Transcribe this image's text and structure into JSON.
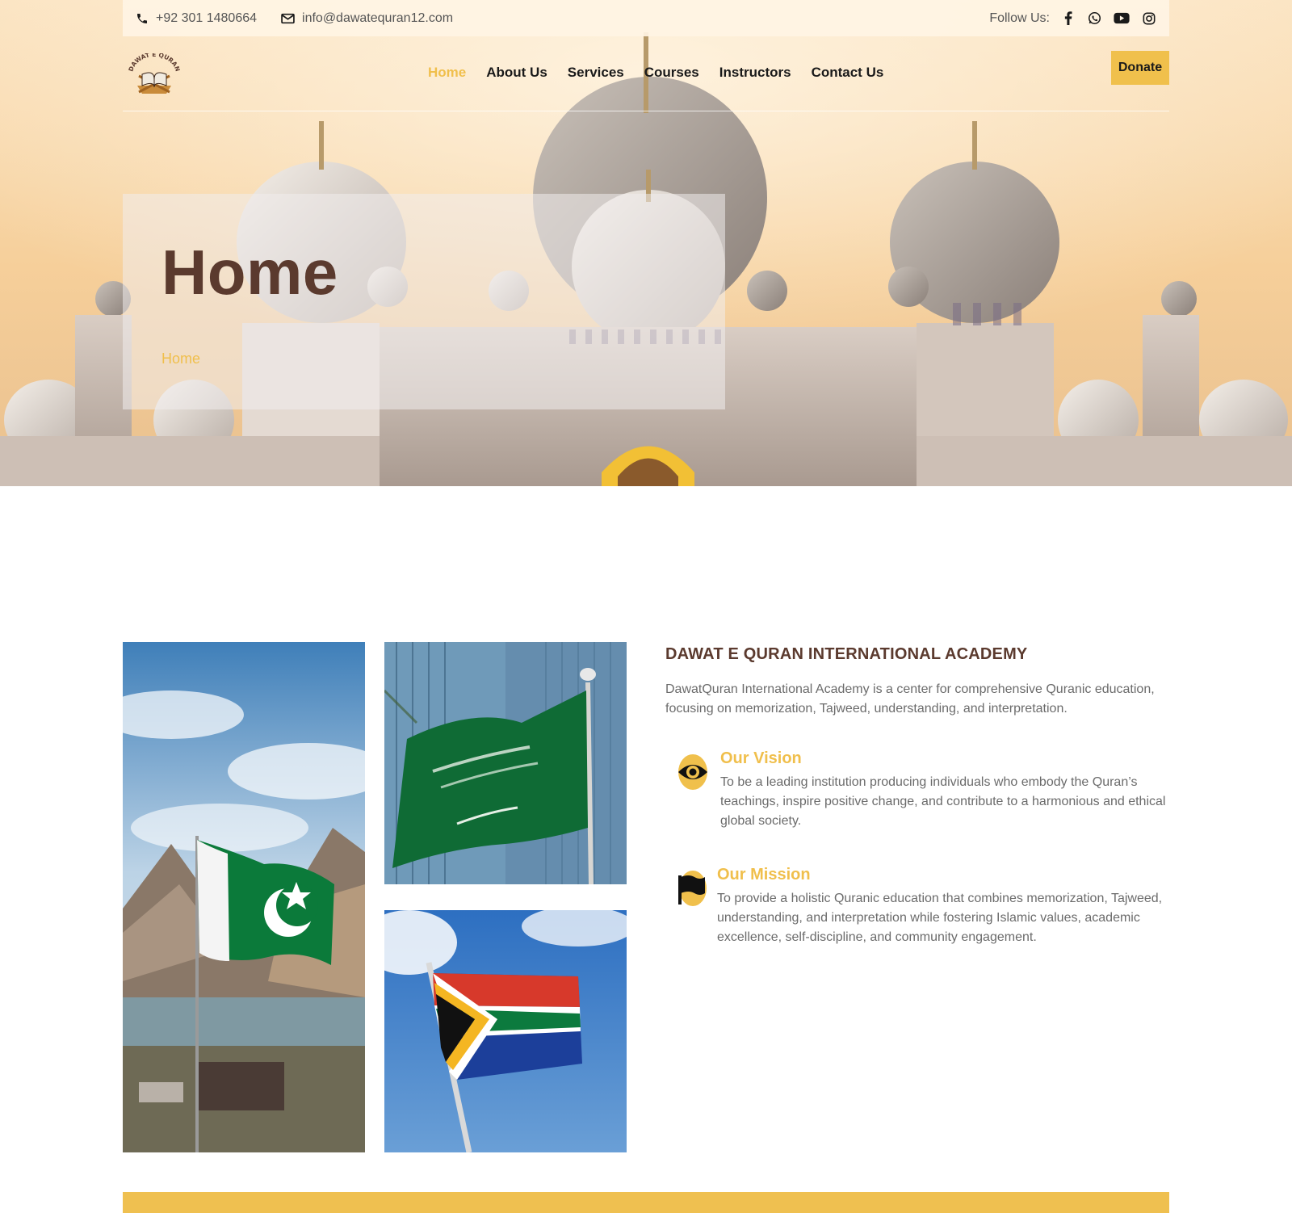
{
  "topbar": {
    "phone": "+92 301 1480664",
    "email": "info@dawatequran12.com",
    "follow_label": "Follow Us:",
    "socials": [
      "facebook-icon",
      "whatsapp-icon",
      "youtube-icon",
      "instagram-icon"
    ]
  },
  "nav": {
    "logo_text": "DAWAT E QURAN",
    "items": [
      "Home",
      "About Us",
      "Services",
      "Courses",
      "Instructors",
      "Contact Us"
    ],
    "active": "Home",
    "donate_label": "Donate"
  },
  "hero": {
    "title": "Home",
    "breadcrumb": "Home"
  },
  "about": {
    "heading": "DAWAT E QURAN INTERNATIONAL ACADEMY",
    "text": "DawatQuran International Academy is a center for comprehensive Quranic education, focusing on memorization, Tajweed, understanding, and interpretation.",
    "vision": {
      "title": "Our Vision",
      "text": "To be a leading institution producing individuals who embody the Quran’s teachings, inspire positive change, and contribute to a harmonious and ethical global society.",
      "icon": "eye-icon"
    },
    "mission": {
      "title": "Our Mission",
      "text": "To provide a holistic Quranic education that combines memorization, Tajweed, understanding, and interpretation while fostering Islamic values, academic excellence, self-discipline, and community engagement.",
      "icon": "flag-icon"
    }
  },
  "colors": {
    "accent": "#f0c04c",
    "heading_brown": "#5b3a2e",
    "body_text": "#6b6b6b"
  }
}
